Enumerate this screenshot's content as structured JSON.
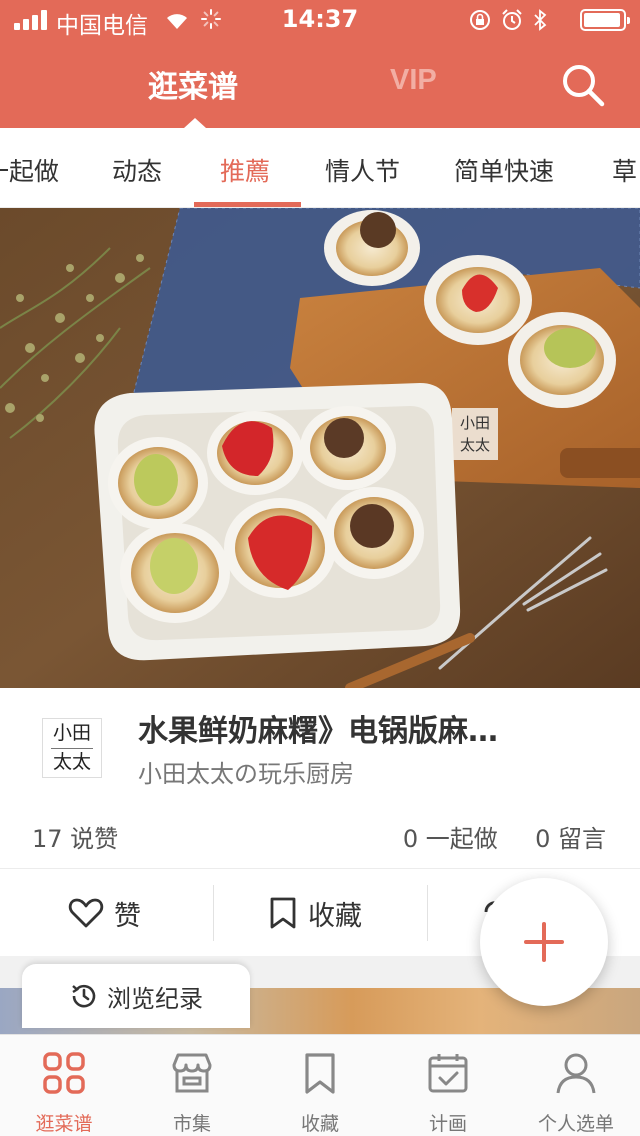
{
  "status_bar": {
    "carrier": "中国电信",
    "time": "14:37"
  },
  "header": {
    "tabs": [
      {
        "label": "逛菜谱",
        "active": true
      },
      {
        "label": "VIP",
        "active": false
      }
    ],
    "search_icon": "search-icon"
  },
  "categories": {
    "items": [
      {
        "label": "一起做"
      },
      {
        "label": "动态"
      },
      {
        "label": "推薦",
        "active": true
      },
      {
        "label": "情人节"
      },
      {
        "label": "简单快速"
      },
      {
        "label": "草"
      }
    ]
  },
  "recipe": {
    "avatar_text": [
      "小田",
      "太太"
    ],
    "watermark_text": [
      "小田",
      "太太"
    ],
    "title": "水果鲜奶麻糬》电锅版麻…",
    "author": "小田太太の玩乐厨房",
    "likes": "17 说赞",
    "cook_together": "0 一起做",
    "comments": "0 留言"
  },
  "actions": {
    "like_label": "赞",
    "save_label": "收藏"
  },
  "history": {
    "label": "浏览纪录"
  },
  "fab": {
    "icon": "plus-icon"
  },
  "bottom_nav": {
    "items": [
      {
        "label": "逛菜谱",
        "icon": "grid-icon",
        "active": true
      },
      {
        "label": "市集",
        "icon": "store-icon",
        "active": false
      },
      {
        "label": "收藏",
        "icon": "bookmark-icon",
        "active": false
      },
      {
        "label": "计画",
        "icon": "calendar-check-icon",
        "active": false
      },
      {
        "label": "个人选单",
        "icon": "person-icon",
        "active": false
      }
    ]
  },
  "colors": {
    "brand": "#e36a58",
    "vip_inactive": "#f2aea3",
    "text": "#333333",
    "muted": "#777777"
  }
}
